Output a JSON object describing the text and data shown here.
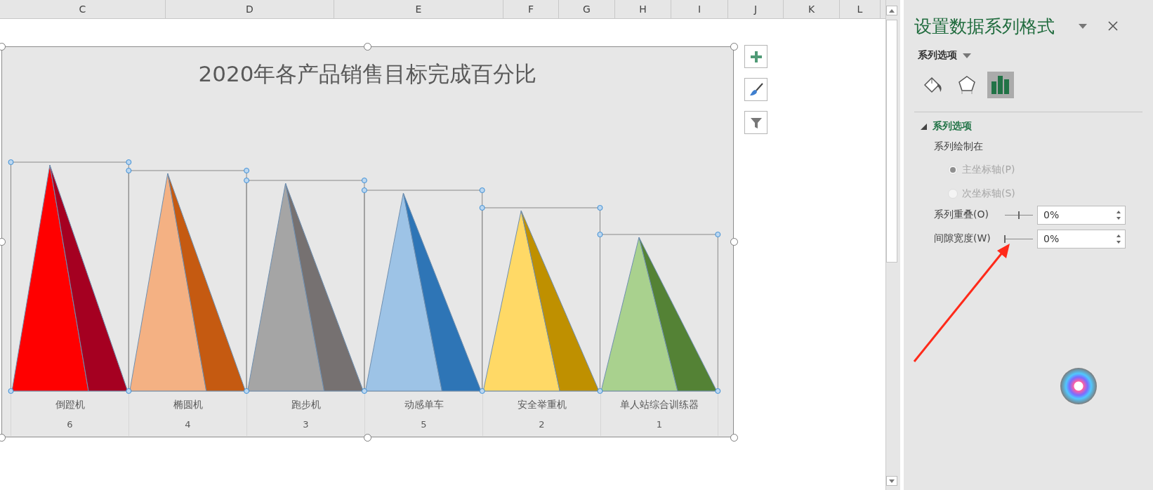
{
  "columns": [
    "C",
    "D",
    "E",
    "F",
    "G",
    "H",
    "I",
    "J",
    "K",
    "L"
  ],
  "chart": {
    "title": "2020年各产品销售目标完成百分比",
    "items": [
      {
        "name": "倒蹬机",
        "number": "6",
        "faces": [
          {
            "color": "#ff0000"
          },
          {
            "color": "#a50021"
          }
        ]
      },
      {
        "name": "椭圆机",
        "number": "4",
        "faces": [
          {
            "color": "#f4b183"
          },
          {
            "color": "#c55a11"
          }
        ]
      },
      {
        "name": "跑步机",
        "number": "3",
        "faces": [
          {
            "color": "#a5a5a5"
          },
          {
            "color": "#767171"
          }
        ]
      },
      {
        "name": "动感单车",
        "number": "5",
        "faces": [
          {
            "color": "#9dc3e6"
          },
          {
            "color": "#2e75b6"
          }
        ]
      },
      {
        "name": "安全举重机",
        "number": "2",
        "faces": [
          {
            "color": "#ffd966"
          },
          {
            "color": "#bf9000"
          }
        ]
      },
      {
        "name": "单人站综合训练器",
        "number": "1",
        "faces": [
          {
            "color": "#a9d18e"
          },
          {
            "color": "#548235"
          }
        ]
      }
    ]
  },
  "panel": {
    "title": "设置数据系列格式",
    "menu_label": "系列选项",
    "icon_tabs": [
      {
        "kind": "fill",
        "selected": false
      },
      {
        "kind": "effects",
        "selected": false
      },
      {
        "kind": "series",
        "selected": true
      }
    ],
    "section": {
      "title": "系列选项",
      "expanded": true,
      "plot_on_label": "系列绘制在",
      "axes": [
        {
          "label": "主坐标轴(P)",
          "selected": true,
          "disabled": true
        },
        {
          "label": "次坐标轴(S)",
          "selected": false,
          "disabled": true
        }
      ],
      "settings": [
        {
          "label": "系列重叠(O)",
          "level": 0.5,
          "value": "0%"
        },
        {
          "label": "间隙宽度(W)",
          "level": 0,
          "value": "0%"
        }
      ]
    }
  }
}
